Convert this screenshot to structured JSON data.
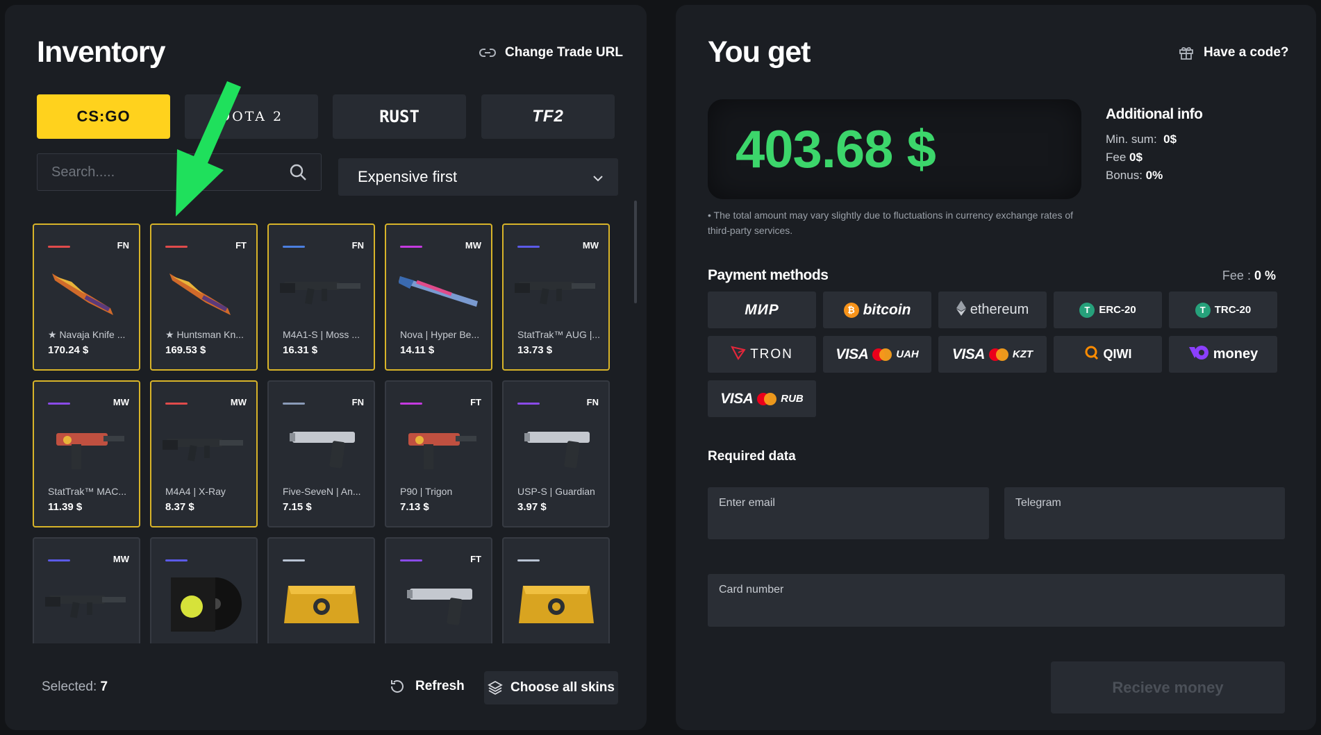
{
  "inventory": {
    "title": "Inventory",
    "change_trade_url": "Change Trade URL",
    "games": [
      {
        "label": "CS:GO",
        "active": true
      },
      {
        "label": "DOTA 2",
        "active": false
      },
      {
        "label": "RUST",
        "active": false
      },
      {
        "label": "TF2",
        "active": false
      }
    ],
    "search_placeholder": "Search.....",
    "sort_value": "Expensive first",
    "items": [
      {
        "wear": "FN",
        "rarity_color": "#e04b4b",
        "name": "★ Navaja Knife ...",
        "price": "170.24 $",
        "selected": true,
        "icon": "knife-icon"
      },
      {
        "wear": "FT",
        "rarity_color": "#e04b4b",
        "name": "★ Huntsman Kn...",
        "price": "169.53 $",
        "selected": true,
        "icon": "knife-icon"
      },
      {
        "wear": "FN",
        "rarity_color": "#4b7fe0",
        "name": "M4A1-S | Moss ...",
        "price": "16.31 $",
        "selected": true,
        "icon": "rifle-icon"
      },
      {
        "wear": "MW",
        "rarity_color": "#c43ae0",
        "name": "Nova | Hyper Be...",
        "price": "14.11 $",
        "selected": true,
        "icon": "shotgun-icon"
      },
      {
        "wear": "MW",
        "rarity_color": "#5b5ae8",
        "name": "StatTrak™ AUG |...",
        "price": "13.73 $",
        "selected": true,
        "icon": "rifle-icon"
      },
      {
        "wear": "MW",
        "rarity_color": "#8a4be8",
        "name": "StatTrak™ MAC...",
        "price": "11.39 $",
        "selected": true,
        "icon": "smg-icon"
      },
      {
        "wear": "MW",
        "rarity_color": "#e04b4b",
        "name": "M4A4 | X-Ray",
        "price": "8.37 $",
        "selected": true,
        "icon": "rifle-icon"
      },
      {
        "wear": "FN",
        "rarity_color": "#8a9bb8",
        "name": "Five-SeveN | An...",
        "price": "7.15 $",
        "selected": false,
        "icon": "pistol-icon"
      },
      {
        "wear": "FT",
        "rarity_color": "#c43ae0",
        "name": "P90 | Trigon",
        "price": "7.13 $",
        "selected": false,
        "icon": "smg-icon"
      },
      {
        "wear": "FN",
        "rarity_color": "#8a4be8",
        "name": "USP-S | Guardian",
        "price": "3.97 $",
        "selected": false,
        "icon": "pistol-icon"
      },
      {
        "wear": "MW",
        "rarity_color": "#5b5ae8",
        "name": "",
        "price": "",
        "selected": false,
        "icon": "rifle-icon"
      },
      {
        "wear": "",
        "rarity_color": "#5b5ae8",
        "name": "",
        "price": "",
        "selected": false,
        "icon": "music-kit-icon"
      },
      {
        "wear": "",
        "rarity_color": "#b9c3d3",
        "name": "",
        "price": "",
        "selected": false,
        "icon": "case-icon"
      },
      {
        "wear": "FT",
        "rarity_color": "#8a4be8",
        "name": "",
        "price": "",
        "selected": false,
        "icon": "pistol-icon"
      },
      {
        "wear": "",
        "rarity_color": "#b9c3d3",
        "name": "",
        "price": "",
        "selected": false,
        "icon": "case-icon"
      }
    ],
    "selected_label": "Selected:",
    "selected_count": "7",
    "refresh_label": "Refresh",
    "choose_all_label": "Choose all skins"
  },
  "checkout": {
    "title": "You get",
    "have_code": "Have a code?",
    "amount": "403.68 $",
    "additional_title": "Additional info",
    "min_sum_label": "Min. sum:",
    "min_sum_value": "0$",
    "fee_label": "Fee",
    "fee_value": "0$",
    "bonus_label": "Bonus:",
    "bonus_value": "0%",
    "note": "• The total amount may vary slightly due to fluctuations in currency exchange rates of third-party services.",
    "payment_title": "Payment methods",
    "payment_fee_label": "Fee :",
    "payment_fee_value": "0 %",
    "methods": {
      "mir": "МИР",
      "bitcoin": "bitcoin",
      "ethereum": "ethereum",
      "erc20": "ERC-20",
      "trc20": "TRC-20",
      "tron": "TRON",
      "visa_uah": "VISA",
      "uah": "UAH",
      "visa_kzt": "VISA",
      "kzt": "KZT",
      "qiwi": "QIWI",
      "money": "money",
      "visa_rub": "VISA",
      "rub": "RUB"
    },
    "required_title": "Required data",
    "email_placeholder": "Enter email",
    "telegram_placeholder": "Telegram",
    "card_placeholder": "Card number",
    "receive_label": "Recieve money"
  },
  "colors": {
    "accent_yellow": "#ffd21d",
    "amount_green": "#3cd66b",
    "annotation_arrow": "#1fe05c"
  }
}
